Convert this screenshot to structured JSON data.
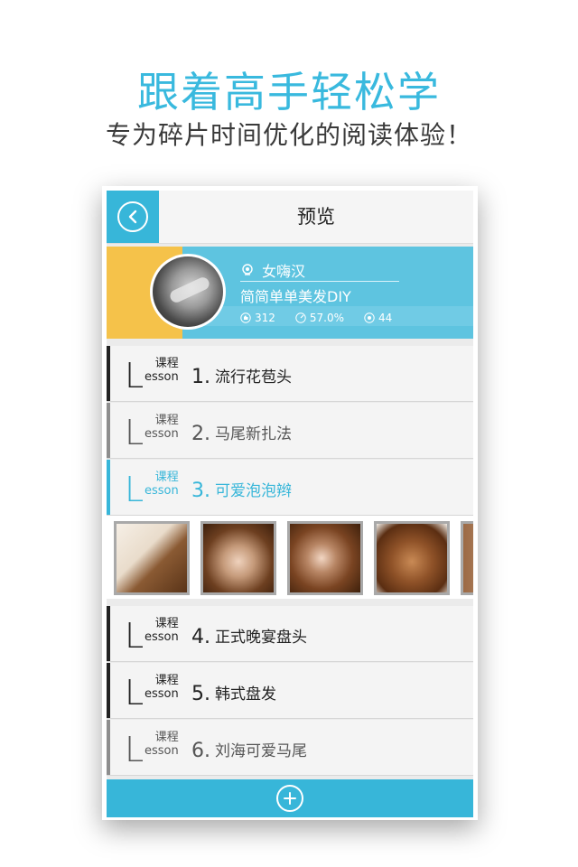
{
  "promo": {
    "title": "跟着高手轻松学",
    "subtitle": "专为碎片时间优化的阅读体验！"
  },
  "navbar": {
    "title": "预览",
    "back_icon": "back-arrow-icon"
  },
  "profile": {
    "name": "女嗨汉",
    "description": "简简单单美发DIY",
    "stats": {
      "likes": "312",
      "progress": "57.0%",
      "count": "44"
    },
    "colors": {
      "accent": "#5ec4e0",
      "yellow": "#f5c24a"
    }
  },
  "lessons": [
    {
      "letter": "L",
      "tag_cn": "课程",
      "tag_en": "esson",
      "num": "1.",
      "title": "流行花苞头"
    },
    {
      "letter": "L",
      "tag_cn": "课程",
      "tag_en": "esson",
      "num": "2.",
      "title": "马尾新扎法"
    },
    {
      "letter": "L",
      "tag_cn": "课程",
      "tag_en": "esson",
      "num": "3.",
      "title": "可爱泡泡辫"
    },
    {
      "letter": "L",
      "tag_cn": "课程",
      "tag_en": "esson",
      "num": "4.",
      "title": "正式晚宴盘头"
    },
    {
      "letter": "L",
      "tag_cn": "课程",
      "tag_en": "esson",
      "num": "5.",
      "title": "韩式盘发"
    },
    {
      "letter": "L",
      "tag_cn": "课程",
      "tag_en": "esson",
      "num": "6.",
      "title": "刘海可爱马尾"
    }
  ],
  "footer": {
    "icon": "plus-icon"
  },
  "theme": {
    "accent": "#37b6d9"
  }
}
